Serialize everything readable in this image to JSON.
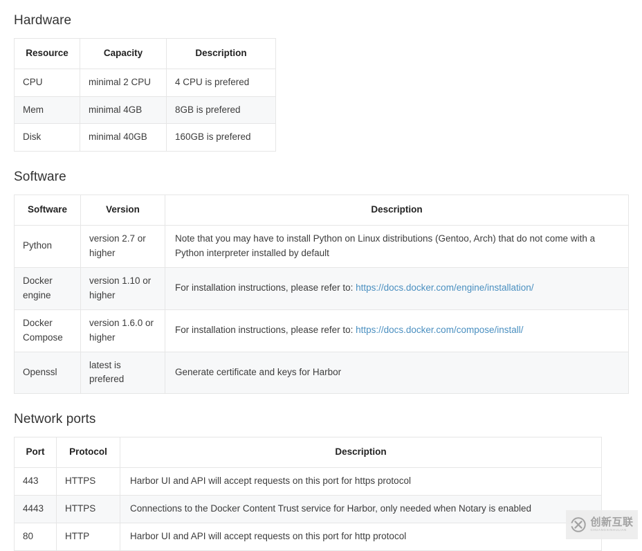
{
  "sections": [
    {
      "id": "hardware",
      "title": "Hardware",
      "headers": [
        "Resource",
        "Capacity",
        "Description"
      ],
      "rows": [
        [
          "CPU",
          "minimal 2 CPU",
          "4 CPU is prefered"
        ],
        [
          "Mem",
          "minimal 4GB",
          "8GB is prefered"
        ],
        [
          "Disk",
          "minimal 40GB",
          "160GB is prefered"
        ]
      ]
    },
    {
      "id": "software",
      "title": "Software",
      "headers": [
        "Software",
        "Version",
        "Description"
      ],
      "rows": [
        {
          "name": "Python",
          "version": "version 2.7 or higher",
          "description_prefix": "Note that you may have to install Python on Linux distributions (Gentoo, Arch) that do not come with a Python interpreter installed by default",
          "link_text": "",
          "link_suffix": ""
        },
        {
          "name": "Docker engine",
          "version": "version 1.10 or higher",
          "description_prefix": "For installation instructions, please refer to: ",
          "link_text": "https://docs.docker.com/engine/installation/",
          "link_suffix": ""
        },
        {
          "name": "Docker Compose",
          "version": "version 1.6.0 or higher",
          "description_prefix": "For installation instructions, please refer to: ",
          "link_text": "https://docs.docker.com/compose/install/",
          "link_suffix": ""
        },
        {
          "name": "Openssl",
          "version": "latest is prefered",
          "description_prefix": "Generate certificate and keys for Harbor",
          "link_text": "",
          "link_suffix": ""
        }
      ]
    },
    {
      "id": "ports",
      "title": "Network ports",
      "headers": [
        "Port",
        "Protocol",
        "Description"
      ],
      "rows": [
        [
          "443",
          "HTTPS",
          "Harbor UI and API will accept requests on this port for https protocol"
        ],
        [
          "4443",
          "HTTPS",
          "Connections to the Docker Content Trust service for Harbor, only needed when Notary is enabled"
        ],
        [
          "80",
          "HTTP",
          "Harbor UI and API will accept requests on this port for http protocol"
        ]
      ]
    }
  ],
  "watermark": {
    "main_text": "创新互联",
    "sub_text": "CHUANGXINHULIAN",
    "logo_glyph": "X"
  },
  "colors": {
    "link": "#4a8fc0",
    "border": "#e6e6e6",
    "stripe": "#f7f8f9",
    "text": "#333333"
  }
}
